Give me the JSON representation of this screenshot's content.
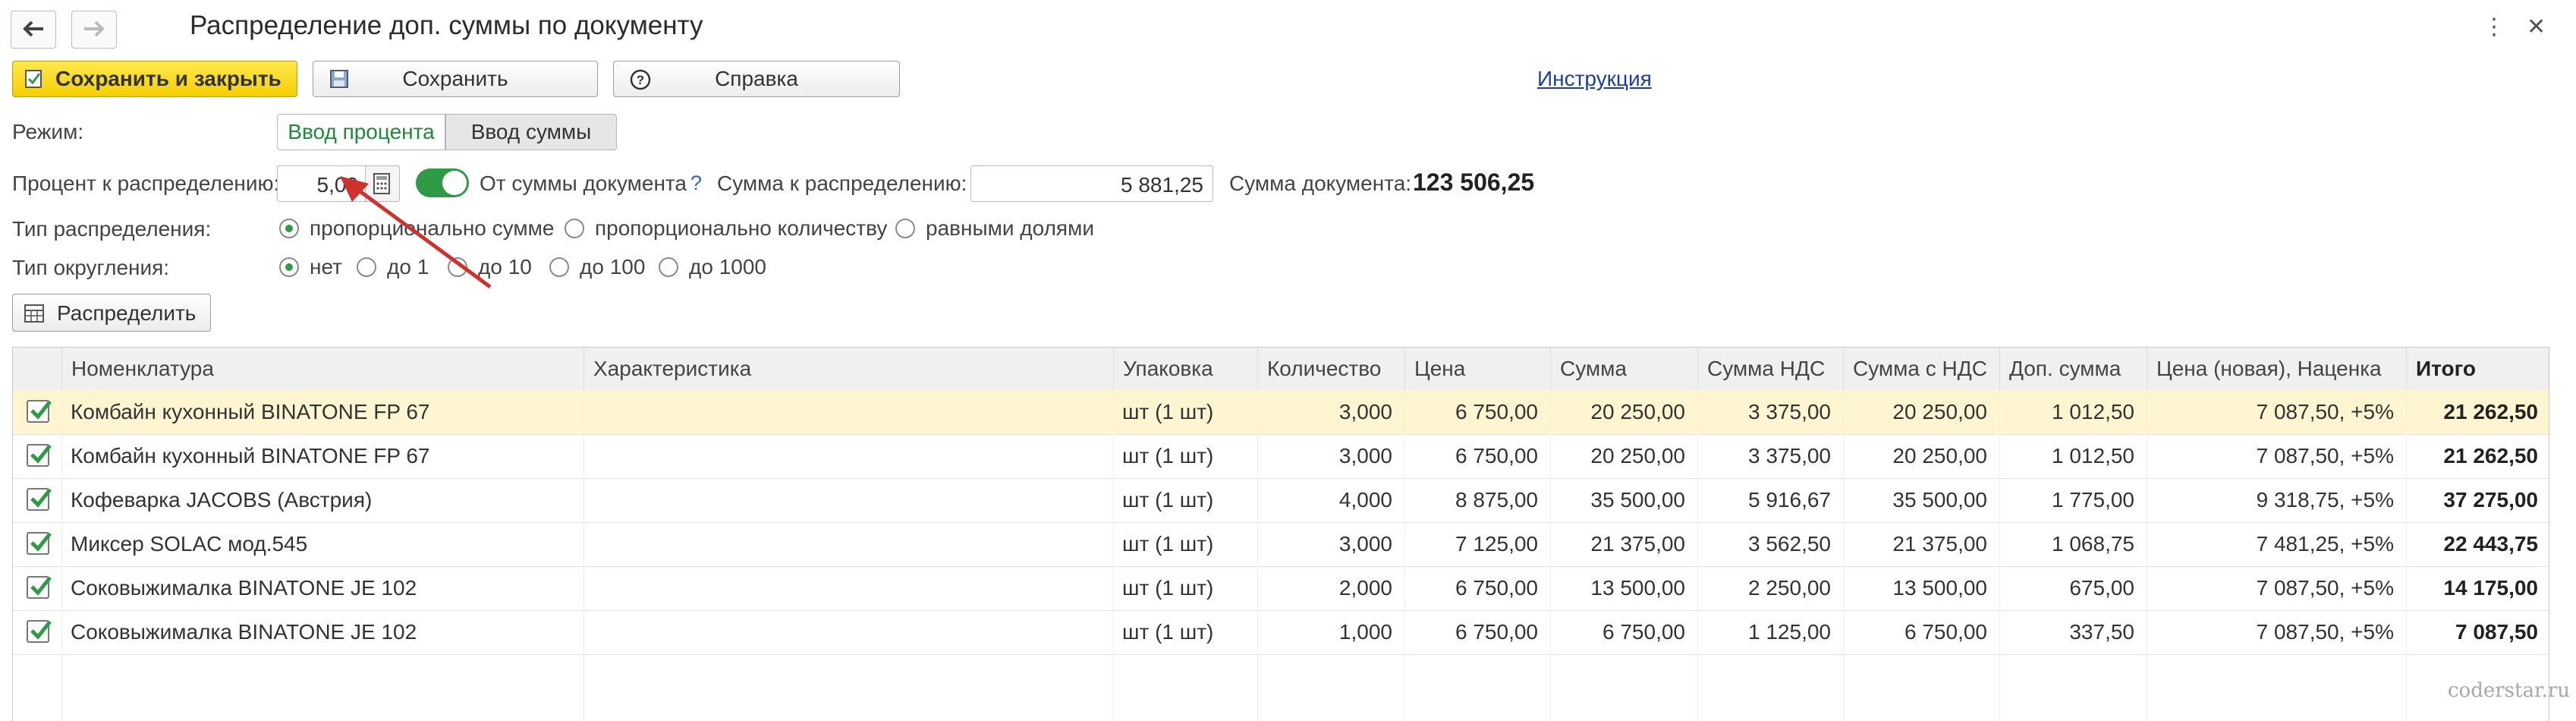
{
  "window": {
    "title": "Распределение доп. суммы по документу",
    "more_icon": "more-vertical-icon",
    "close_icon": "close-icon"
  },
  "toolbar": {
    "save_close": "Сохранить и закрыть",
    "save": "Сохранить",
    "help": "Справка",
    "instruction": "Инструкция"
  },
  "form": {
    "mode_label": "Режим:",
    "mode_percent": "Ввод процента",
    "mode_sum": "Ввод суммы",
    "percent_label": "Процент к распределению:",
    "percent_value": "5,00",
    "from_doc_sum_label": "От суммы документа",
    "help_mark": "?",
    "sum_label": "Сумма к распределению:",
    "sum_value": "5 881,25",
    "doc_sum_label": "Сумма документа:",
    "doc_sum_value": "123 506,25",
    "dist_type_label": "Тип распределения:",
    "dist_types": [
      "пропорционально сумме",
      "пропорционально количеству",
      "равными долями"
    ],
    "rounding_label": "Тип округления:",
    "roundings": [
      "нет",
      "до 1",
      "до 10",
      "до 100",
      "до 1000"
    ],
    "distribute_button": "Распределить"
  },
  "table": {
    "columns": [
      "Номенклатура",
      "Характеристика",
      "Упаковка",
      "Количество",
      "Цена",
      "Сумма",
      "Сумма НДС",
      "Сумма с НДС",
      "Доп. сумма",
      "Цена (новая), Наценка",
      "Итого"
    ],
    "rows": [
      {
        "name": "Комбайн кухонный BINATONE FP 67",
        "char": "",
        "pack": "шт (1 шт)",
        "qty": "3,000",
        "price": "6 750,00",
        "sum": "20 250,00",
        "vat": "3 375,00",
        "sum_vat": "20 250,00",
        "extra": "1 012,50",
        "new_price": "7 087,50, +5%",
        "total": "21 262,50"
      },
      {
        "name": "Комбайн кухонный BINATONE FP 67",
        "char": "",
        "pack": "шт (1 шт)",
        "qty": "3,000",
        "price": "6 750,00",
        "sum": "20 250,00",
        "vat": "3 375,00",
        "sum_vat": "20 250,00",
        "extra": "1 012,50",
        "new_price": "7 087,50, +5%",
        "total": "21 262,50"
      },
      {
        "name": "Кофеварка JACOBS (Австрия)",
        "char": "",
        "pack": "шт (1 шт)",
        "qty": "4,000",
        "price": "8 875,00",
        "sum": "35 500,00",
        "vat": "5 916,67",
        "sum_vat": "35 500,00",
        "extra": "1 775,00",
        "new_price": "9 318,75, +5%",
        "total": "37 275,00"
      },
      {
        "name": "Миксер SOLAC мод.545",
        "char": "",
        "pack": "шт (1 шт)",
        "qty": "3,000",
        "price": "7 125,00",
        "sum": "21 375,00",
        "vat": "3 562,50",
        "sum_vat": "21 375,00",
        "extra": "1 068,75",
        "new_price": "7 481,25, +5%",
        "total": "22 443,75"
      },
      {
        "name": "Соковыжималка  BINATONE JE 102",
        "char": "",
        "pack": "шт (1 шт)",
        "qty": "2,000",
        "price": "6 750,00",
        "sum": "13 500,00",
        "vat": "2 250,00",
        "sum_vat": "13 500,00",
        "extra": "675,00",
        "new_price": "7 087,50, +5%",
        "total": "14 175,00"
      },
      {
        "name": "Соковыжималка  BINATONE JE 102",
        "char": "",
        "pack": "шт (1 шт)",
        "qty": "1,000",
        "price": "6 750,00",
        "sum": "6 750,00",
        "vat": "1 125,00",
        "sum_vat": "6 750,00",
        "extra": "337,50",
        "new_price": "7 087,50, +5%",
        "total": "7 087,50"
      }
    ]
  },
  "watermark": "coderstar.ru",
  "colors": {
    "accent_green": "#2f9a45",
    "primary_yellow": "#f5cf00",
    "selected_row": "#fff6d1",
    "annotation_arrow": "#d0312d"
  }
}
